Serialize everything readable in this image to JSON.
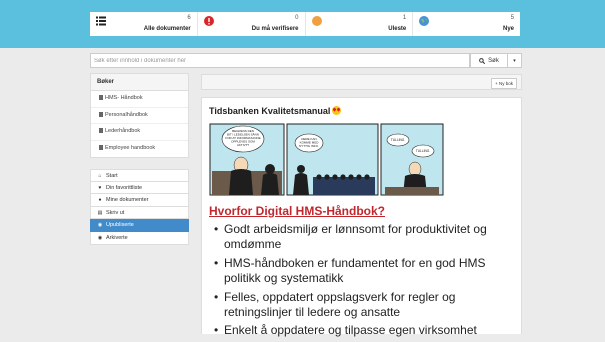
{
  "stats": [
    {
      "count": "6",
      "label": "Alle dokumenter",
      "icon": "list-icon",
      "color": "#222222"
    },
    {
      "count": "0",
      "label": "Du må verifisere",
      "icon": "alert-icon",
      "color": "#d9262d"
    },
    {
      "count": "1",
      "label": "Uleste",
      "icon": "circle-icon",
      "color": "#f0a040"
    },
    {
      "count": "5",
      "label": "Nye",
      "icon": "globe-icon",
      "color": "#4a8fd8"
    }
  ],
  "search": {
    "placeholder": "Søk etter innhold i dokumenter her",
    "button_label": "Søk"
  },
  "books": {
    "header": "Bøker",
    "items": [
      "HMS- Håndbok",
      "Personalhåndbok",
      "Lederhåndbok",
      "Employee handbook"
    ]
  },
  "nav": {
    "items": [
      {
        "label": "Start",
        "icon": "home-icon"
      },
      {
        "label": "Din favorittliste",
        "icon": "heart-icon"
      },
      {
        "label": "Mine dokumenter",
        "icon": "user-icon"
      },
      {
        "label": "Skriv ut",
        "icon": "print-icon"
      },
      {
        "label": "Upubliserte",
        "icon": "eye-icon"
      },
      {
        "label": "Arkiverte",
        "icon": "eye-icon"
      }
    ]
  },
  "toolbar": {
    "new_book_label": "+ Ny bok"
  },
  "document": {
    "title": "Tidsbanken Kvalitetsmanual",
    "heading": "Hvorfor Digital HMS-Håndbok?",
    "bullets": [
      "Godt arbeidsmiljø er lønnsomt for produktivitet og omdømme",
      "HMS-håndboken er fundamentet for en god HMS politikk og systematikk",
      "Felles, oppdatert oppslagsverk for regler og retningslinjer til ledere og ansatte",
      "Enkelt å oppdatere og tilpasse egen virksomhet"
    ]
  },
  "comic": {
    "panel1_text": "BEGRENS DEN BIT I LEDELSEN SÅNN FOR AT INFORMASJONE OPPLEVES SOM AKTIVT?",
    "panel2_text": "DERE KAN KOMME MED NYTTIG INFO.",
    "panel3_text1": "TULLING.",
    "panel3_text2": "TULLING."
  },
  "colors": {
    "accent": "#5bc0de",
    "active_nav": "#428bca",
    "heading": "#c0272d"
  }
}
